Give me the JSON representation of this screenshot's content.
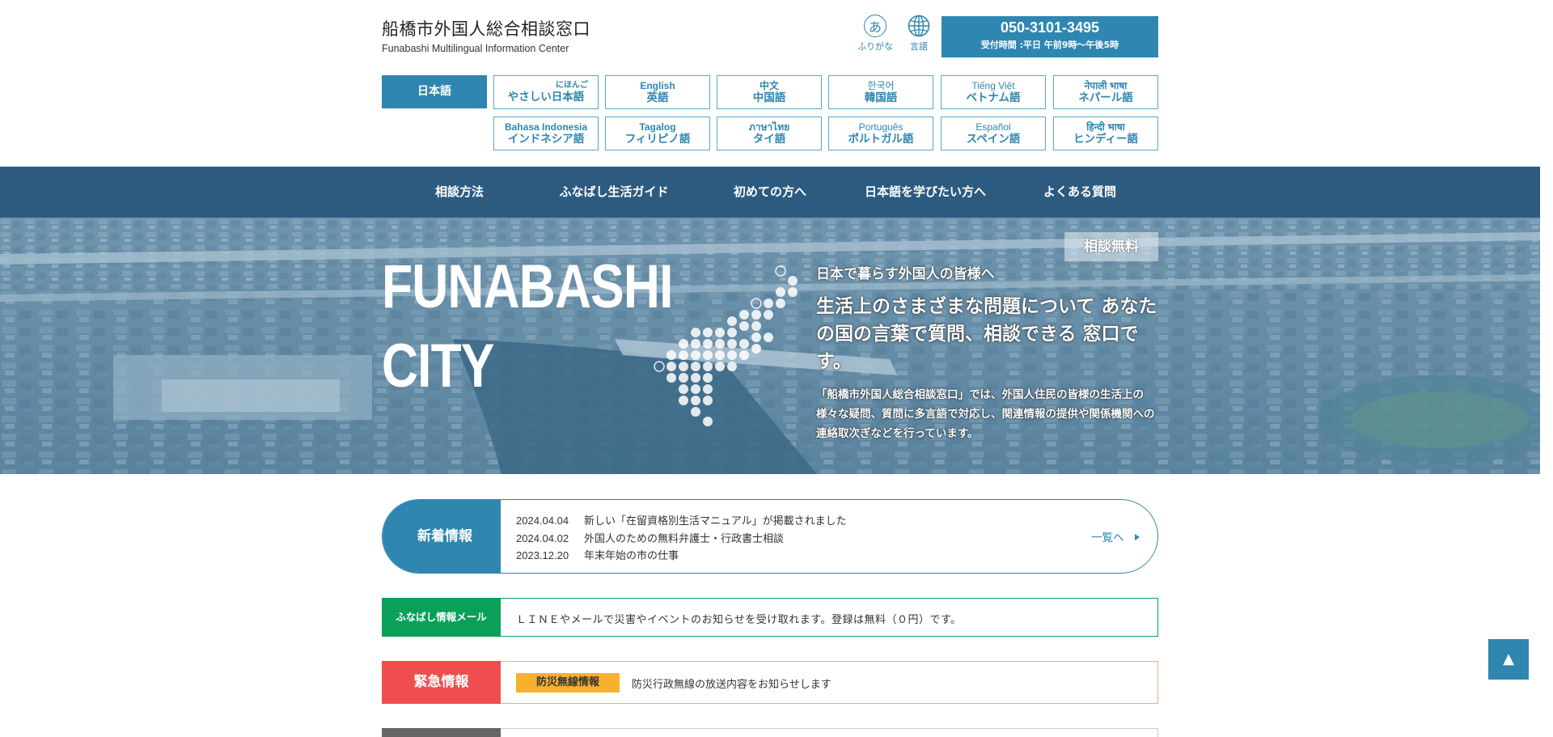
{
  "header": {
    "title": "船橋市外国人総合相談窓口",
    "subtitle": "Funabashi Multilingual Information Center",
    "tools": {
      "furigana_glyph": "あ",
      "furigana_label": "ふりがな",
      "language_label": "言語"
    },
    "phone": {
      "number": "050-3101-3495",
      "hours": "受付時間 :平日 午前9時〜午後5時"
    }
  },
  "languages": {
    "active": "日本語",
    "items": [
      {
        "native": "にほんご",
        "ja": "やさしい日本語"
      },
      {
        "native": "English",
        "ja": "英語"
      },
      {
        "native": "中文",
        "ja": "中国語"
      },
      {
        "native": "한국어",
        "ja": "韓国語"
      },
      {
        "native": "Tiếng Việt",
        "ja": "ベトナム語"
      },
      {
        "native": "नेपाली भाषा",
        "ja": "ネパール語"
      },
      {
        "native": "Bahasa Indonesia",
        "ja": "インドネシア語"
      },
      {
        "native": "Tagalog",
        "ja": "フィリピノ語"
      },
      {
        "native": "ภาษาไทย",
        "ja": "タイ語"
      },
      {
        "native": "Português",
        "ja": "ポルトガル語"
      },
      {
        "native": "Español",
        "ja": "スペイン語"
      },
      {
        "native": "हिन्दी भाषा",
        "ja": "ヒンディー語"
      }
    ]
  },
  "nav": {
    "items": [
      "相談方法",
      "ふなばし生活ガイド",
      "初めての方へ",
      "日本語を学びたい方へ",
      "よくある質問"
    ]
  },
  "hero": {
    "title_line1": "FUNABASHI",
    "title_line2": "CITY",
    "badge": "相談無料",
    "lead": "日本で暮らす外国人の皆様へ",
    "heading": "生活上のさまざまな問題について あなたの国の言葉で質問、相談できる 窓口です。",
    "description": "「船橋市外国人総合相談窓口」では、外国人住民の皆様の生活上の様々な疑問、質問に多言語で対応し、関連情報の提供や関係機関への連絡取次ぎなどを行っています。"
  },
  "news": {
    "label": "新着情報",
    "items": [
      {
        "date": "2024.04.04",
        "title": "新しい「在留資格別生活マニュアル」が掲載されました"
      },
      {
        "date": "2024.04.02",
        "title": "外国人のための無料弁護士・行政書士相談"
      },
      {
        "date": "2023.12.20",
        "title": "年末年始の市の仕事"
      }
    ],
    "more": "一覧へ"
  },
  "mail": {
    "label": "ふなばし情報メール",
    "text": "ＬＩＮＥやメールで災害やイベントのお知らせを受け取れます。登録は無料（０円）です。"
  },
  "emergency": {
    "label": "緊急情報",
    "tag": "防災無線情報",
    "text": "防災行政無線の放送内容をお知らせします"
  },
  "totop": "▲",
  "colors": {
    "primary": "#2f86b0",
    "nav": "#2d5b80",
    "mail": "#0aa05a",
    "emergency": "#ee4e4e",
    "tag": "#f7b12f"
  }
}
